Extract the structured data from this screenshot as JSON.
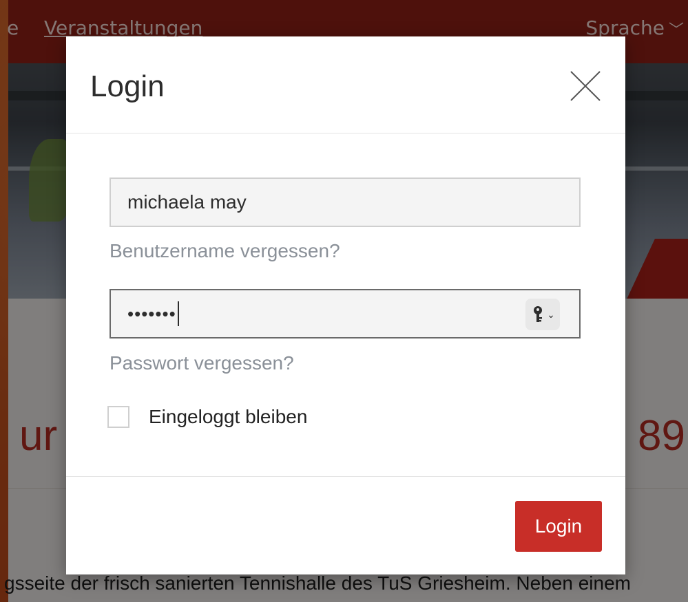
{
  "background_page": {
    "nav": {
      "partial_item": "e",
      "item": "Veranstaltungen",
      "language": "Sprache",
      "language_chevron": "﹀"
    },
    "heading_left": "ur",
    "heading_right": "89",
    "body_text": "gsseite der frisch sanierten Tennishalle des TuS Griesheim. Neben einem"
  },
  "modal": {
    "title": "Login",
    "close_icon": "close-icon",
    "username": {
      "value": "michaela may"
    },
    "forgot_username": "Benutzername vergessen?",
    "password": {
      "masked_value": "•••••••",
      "key_icon": "key-icon",
      "key_chevron": "⌄"
    },
    "forgot_password": "Passwort vergessen?",
    "remember_me": {
      "label": "Eingeloggt bleiben",
      "checked": false
    },
    "login_button": "Login"
  },
  "colors": {
    "brand_red": "#c82e28",
    "nav_red": "#8f1f17",
    "link_gray": "#8a9098"
  }
}
